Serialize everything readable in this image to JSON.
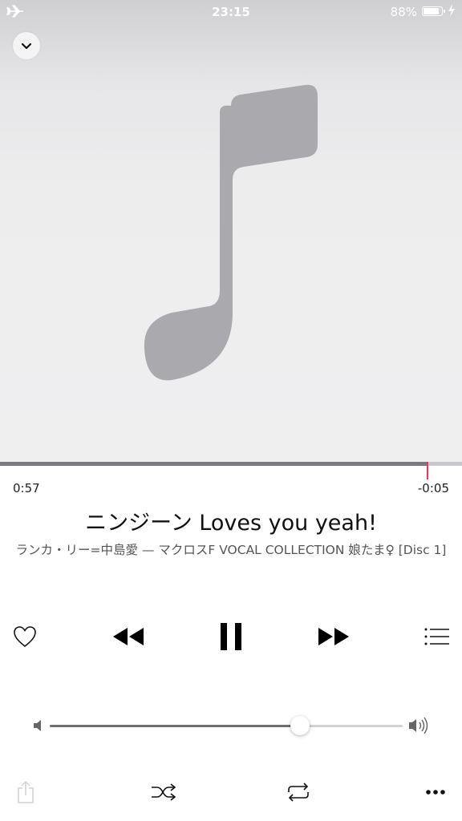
{
  "status_bar": {
    "time": "23:15",
    "battery_text": "88%",
    "battery_level": 0.88,
    "airplane_icon": "airplane-icon",
    "charging_icon": "bolt-icon"
  },
  "artwork": {
    "placeholder_icon": "music-note-icon"
  },
  "playback": {
    "elapsed": "0:57",
    "remaining": "-0:05",
    "progress_fraction": 0.925
  },
  "track": {
    "title": "ニンジーン Loves you yeah!",
    "subtitle": "ランカ・リー=中島愛 — マクロスF VOCAL COLLECTION 娘たま♀ [Disc 1]"
  },
  "volume": {
    "level_fraction": 0.71
  },
  "colors": {
    "accent": "#fa2d55",
    "progress_played": "#7a7a7e",
    "progress_track": "#c7c7cc",
    "artwork_bg": "#efeff0",
    "note_color": "#aaaaae"
  }
}
